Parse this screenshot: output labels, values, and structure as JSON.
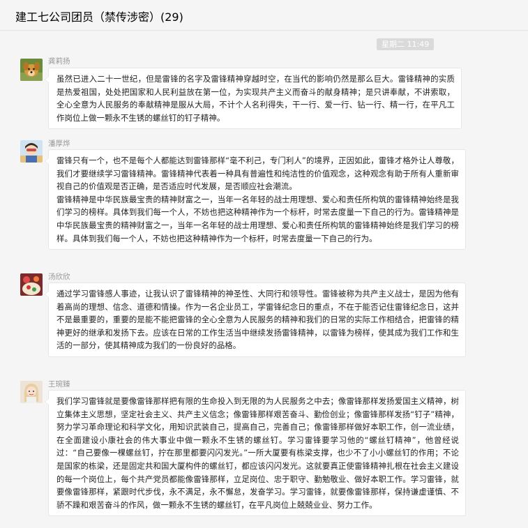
{
  "chat": {
    "title": "建工七公司团员（禁传涉密）(29)",
    "timestamp": "星期二 11:49"
  },
  "messages": [
    {
      "sender": "龚莉扬",
      "avatar": "dog-avatar-icon",
      "paragraphs": [
        "虽然已进入二十一世纪，但是雷锋的名字及雷锋精神穿越时空，在当代的影响仍然是那么巨大。雷锋精神的实质是热爱祖国，处处把国家和人民利益放在第一位，为实现共产主义而奋斗的献身精神；是只讲奉献，不讲索取，全心全意为人民服务的奉献精神是服从大局，不计个人名利得失，干一行、爱一行、钻一行、精一行，在平凡工作岗位上做一颗永不生锈的螺丝钉的钉子精神。"
      ]
    },
    {
      "sender": "潘厚烨",
      "avatar": "cartoon-avatar-icon",
      "paragraphs": [
        "雷锋只有一个，也不是每个人都能达到雷锋那样“毫不利己，专门利人”的境界，正因如此，雷锋才格外让人尊敬，我们才要继续学习雷锋精神。雷锋精神代表着一种具有普遍性和纯洁性的价值观念，这种观念有助于所有人重新审视自己的价值观是否正确，是否适应时代发展，是否顺应社会潮流。",
        "雷锋精神是中华民族最宝贵的精神财富之一，当年一名年轻的战士用理想、爱心和责任所构筑的雷锋精神始终是我们学习的榜样。具体到我们每一个人，不妨也把这种精神作为一个标杆，时常去度量一下自己的行为。雷锋精神是中华民族最宝贵的精神财富之一，当年一名年轻的战士用理想、爱心和责任所构筑的雷锋精神始终是我们学习的榜样。具体到我们每一个人，不妨也把这种精神作为一个标杆，时常去度量一下自己的行为。"
      ]
    },
    {
      "sender": "汤欣欣",
      "avatar": "photo-avatar-icon",
      "paragraphs": [
        "通过学习雷锋感人事迹，让我认识了雷锋精神的神圣性、大同行和领导性。雷锋被称为共产主义战士，是因为他有着高尚的理想、信念、道德和情操。作为一名企业员工，学雷锋纪念日的重点，不在于能否记住雷锋纪念日，这并不是最重要的，重要的是能不能把雷锋的全心全意为人民服务的精神和我们的日常的实际工作相结合，把雷锋的精神更好的继承和发扬下去。应该在日常的工作生活当中继续发扬雷锋精神，以雷锋为榜样，使其成为我们工作和生活的一部分，使其精神成为我们的一份良好的品格。"
      ]
    },
    {
      "sender": "王琬臻",
      "avatar": "girl-avatar-icon",
      "paragraphs": [
        "我们学习雷锋就是要像雷锋那样把有限的生命投入到无限的为人民服务之中去；像雷锋那样发扬爱国主义精神，树立集体主义思想，坚定社会主义、共产主义信念；像雷锋那样艰苦奋斗、勤俭创业；像雷锋那样发扬“钉子”精神，努力学习革命理论和科学文化，用知识武装自己，提高自己，完善自己；像雷锋那样做好本职工作，创一流业绩，在全面建设小康社会的伟大事业中做一颗永不生锈的螺丝钉。学习雷锋要学习他的“螺丝钉精神”，他曾经说过：“自己要像一棵螺丝钉，拧在那里都要闪闪发光。”一所大厦要有栋梁支撑，也少不了小小螺丝钉的作用；不论是国家的栋梁，还是固定共和国大厦构件的螺丝钉，都应该闪闪发光。这就要真正使雷锋精神扎根在社会主义建设的每一个岗位上，每个共产党员都能像雷锋那样，立足岗位、忠于职守、勤勉敬业、做好本职工作。学习雷锋，就要像雷锋那样，紧跟时代步伐，永不满足，永不懈怠，发奋学习。学习雷锋，就要像雷锋那样，保持谦虚谨慎、不骄不躁和艰苦奋斗的作风，做一颗永不生锈的螺丝钉，在平凡岗位上兢兢业业、努力工作。"
      ]
    }
  ]
}
